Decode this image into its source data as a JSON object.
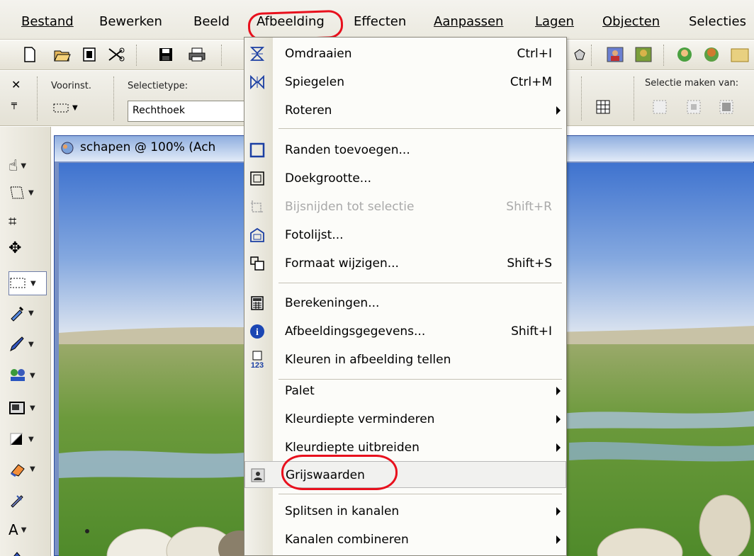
{
  "menubar": {
    "items": [
      "Bestand",
      "Bewerken",
      "Beeld",
      "Afbeelding",
      "Effecten",
      "Aanpassen",
      "Lagen",
      "Objecten",
      "Selecties"
    ],
    "active": "Afbeelding"
  },
  "options": {
    "preset_label": "Voorinst.",
    "selection_type_label": "Selectietype:",
    "selection_type_value": "Rechthoek",
    "make_selection_from_label": "Selectie maken van:"
  },
  "document": {
    "title": "schapen @ 100% (Ach"
  },
  "menu": {
    "items": [
      {
        "label": "Omdraaien",
        "shortcut": "Ctrl+I",
        "icon": "flip-vertical-icon",
        "submenu": false,
        "enabled": true
      },
      {
        "label": "Spiegelen",
        "shortcut": "Ctrl+M",
        "icon": "mirror-icon",
        "submenu": false,
        "enabled": true
      },
      {
        "label": "Roteren",
        "shortcut": "",
        "icon": "",
        "submenu": true,
        "enabled": true
      },
      {
        "label": "Randen toevoegen...",
        "shortcut": "",
        "icon": "add-borders-icon",
        "submenu": false,
        "enabled": true
      },
      {
        "label": "Doekgrootte...",
        "shortcut": "",
        "icon": "canvas-size-icon",
        "submenu": false,
        "enabled": true
      },
      {
        "label": "Bijsnijden tot selectie",
        "shortcut": "Shift+R",
        "icon": "crop-icon",
        "submenu": false,
        "enabled": false
      },
      {
        "label": "Fotolijst...",
        "shortcut": "",
        "icon": "picture-frame-icon",
        "submenu": false,
        "enabled": true
      },
      {
        "label": "Formaat wijzigen...",
        "shortcut": "Shift+S",
        "icon": "resize-icon",
        "submenu": false,
        "enabled": true
      },
      {
        "label": "Berekeningen...",
        "shortcut": "",
        "icon": "calculator-icon",
        "submenu": false,
        "enabled": true
      },
      {
        "label": "Afbeeldingsgegevens...",
        "shortcut": "Shift+I",
        "icon": "info-icon",
        "submenu": false,
        "enabled": true
      },
      {
        "label": "Kleuren in afbeelding tellen",
        "shortcut": "",
        "icon": "count-colors-icon",
        "submenu": false,
        "enabled": true
      },
      {
        "label": "Palet",
        "shortcut": "",
        "icon": "",
        "submenu": true,
        "enabled": true
      },
      {
        "label": "Kleurdiepte verminderen",
        "shortcut": "",
        "icon": "",
        "submenu": true,
        "enabled": true
      },
      {
        "label": "Kleurdiepte uitbreiden",
        "shortcut": "",
        "icon": "",
        "submenu": true,
        "enabled": true
      },
      {
        "label": "Grijswaarden",
        "shortcut": "",
        "icon": "grayscale-icon",
        "submenu": false,
        "enabled": true
      },
      {
        "label": "Splitsen in kanalen",
        "shortcut": "",
        "icon": "",
        "submenu": true,
        "enabled": true
      },
      {
        "label": "Kanalen combineren",
        "shortcut": "",
        "icon": "",
        "submenu": true,
        "enabled": true
      }
    ],
    "highlighted": "Grijswaarden"
  },
  "colors": {
    "annotation_red": "#e8101d",
    "menu_bg": "#fcfcf9",
    "titlebar_blue": "#8faedf"
  }
}
